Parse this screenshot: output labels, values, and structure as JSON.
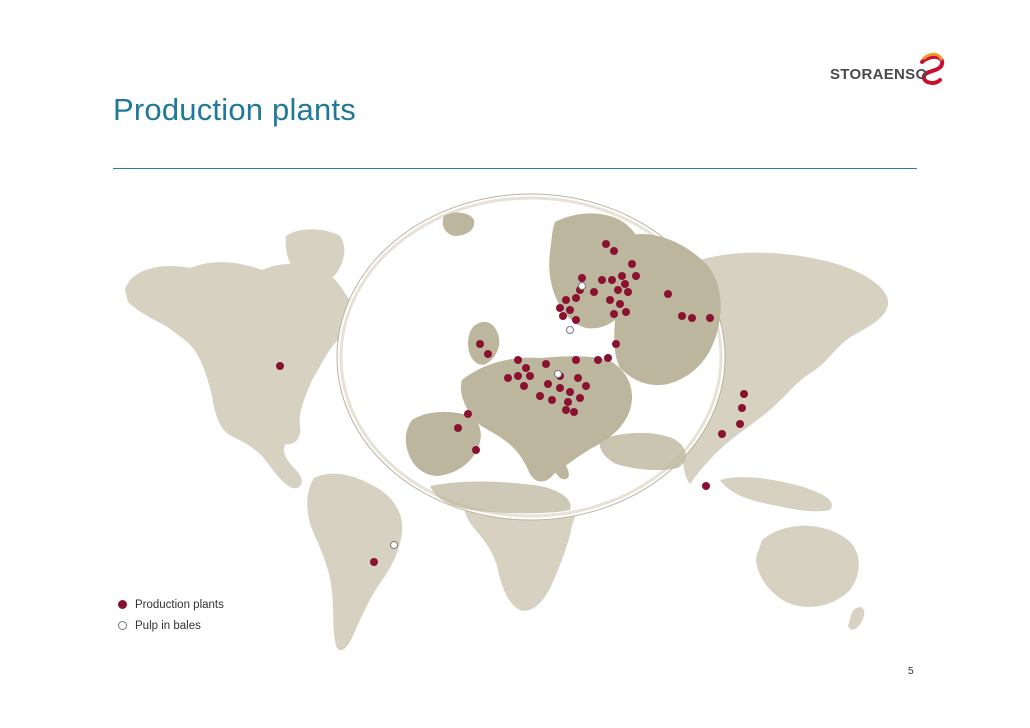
{
  "slide": {
    "title": "Production plants",
    "page_number": "5"
  },
  "logo": {
    "text": "STORAENSO"
  },
  "legend": {
    "production": "Production plants",
    "pulp": "Pulp in bales"
  },
  "colors": {
    "title": "#1f7a97",
    "land": "#d6d1c1",
    "europe_land": "#bdb69e",
    "production_dot": "#8a1230",
    "pulp_dot": "#ffffff",
    "logo_red": "#c8102e",
    "logo_orange": "#f29a2e"
  },
  "icons": {
    "production": "filled-circle-marker",
    "pulp": "hollow-circle-marker"
  }
}
